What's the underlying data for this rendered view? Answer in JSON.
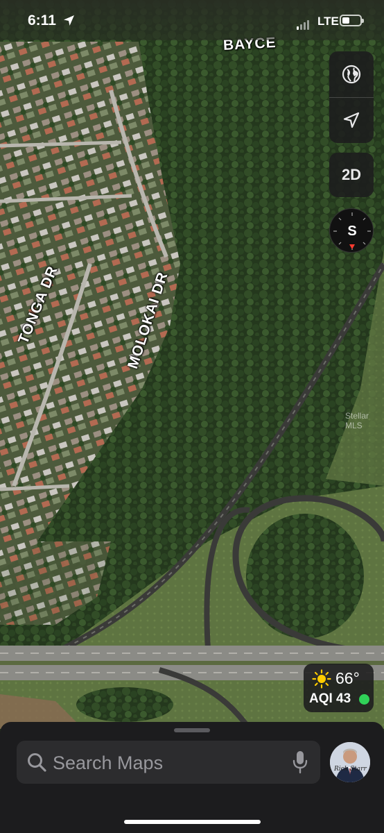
{
  "status_bar": {
    "time": "6:11",
    "network": "LTE",
    "signal_bars_active": 1,
    "battery_level_percent": 40
  },
  "map": {
    "view_mode": "satellite",
    "street_labels": {
      "tonga": "TONGA DR",
      "molokai": "MOLOKAI DR",
      "bayce": "BAYCE"
    },
    "watermark": "Stellar MLS"
  },
  "controls": {
    "globe_icon": "globe-icon",
    "location_icon": "location-arrow-icon",
    "view_toggle_label": "2D",
    "compass_heading": "S"
  },
  "weather": {
    "temperature": "66°",
    "aqi_label": "AQI 43",
    "aqi_color": "#30d158",
    "condition_icon": "sun-icon"
  },
  "search": {
    "placeholder": "Search Maps",
    "icons": [
      "search-icon",
      "microphone-icon"
    ]
  },
  "profile": {
    "avatar_signature": "Rick Starr"
  },
  "colors": {
    "panel_bg": "#1c1c1e",
    "field_bg": "#2c2c2e",
    "compass_needle": "#ff3b30"
  }
}
